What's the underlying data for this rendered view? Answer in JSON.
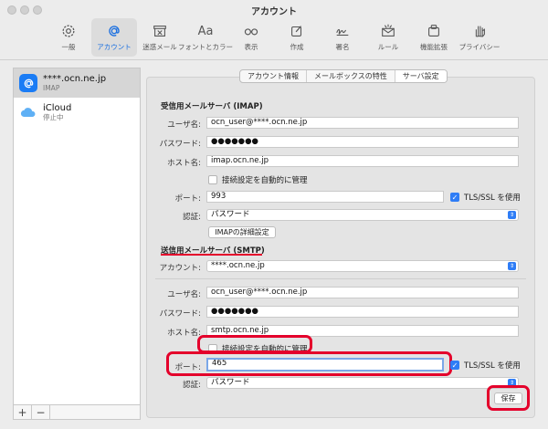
{
  "window": {
    "title": "アカウント"
  },
  "toolbar": {
    "items": [
      {
        "label": "一般",
        "icon": "gear-icon"
      },
      {
        "label": "アカウント",
        "icon": "at-sign-icon",
        "active": true
      },
      {
        "label": "迷惑メール",
        "icon": "junk-mail-icon"
      },
      {
        "label": "フォントとカラー",
        "icon": "font-icon",
        "glyph": "Aa"
      },
      {
        "label": "表示",
        "icon": "glasses-icon"
      },
      {
        "label": "作成",
        "icon": "compose-icon"
      },
      {
        "label": "署名",
        "icon": "signature-icon"
      },
      {
        "label": "ルール",
        "icon": "rules-icon"
      },
      {
        "label": "機能拡張",
        "icon": "extensions-icon"
      },
      {
        "label": "プライバシー",
        "icon": "privacy-hand-icon"
      }
    ]
  },
  "accounts": [
    {
      "name": "****.ocn.ne.jp",
      "sub": "IMAP",
      "selected": true,
      "icon": "at-sign-icon",
      "color": "#1a7cf5"
    },
    {
      "name": "iCloud",
      "sub": "停止中",
      "selected": false,
      "icon": "cloud-icon",
      "color": "#5fb0f5"
    }
  ],
  "list_buttons": {
    "add": "+",
    "remove": "−"
  },
  "tabs": [
    {
      "label": "アカウント情報",
      "active": false
    },
    {
      "label": "メールボックスの特性",
      "active": false
    },
    {
      "label": "サーバ設定",
      "active": true
    }
  ],
  "incoming": {
    "section_title": "受信用メールサーバ (IMAP)",
    "username_label": "ユーザ名:",
    "username": "ocn_user@****.ocn.ne.jp",
    "password_label": "パスワード:",
    "password": "●●●●●●●",
    "host_label": "ホスト名:",
    "host": "imap.ocn.ne.jp",
    "auto_manage_label": "接続設定を自動的に管理",
    "port_label": "ポート:",
    "port": "993",
    "tls_label": "TLS/SSL を使用",
    "auth_label": "認証:",
    "auth": "パスワード",
    "advanced_button": "IMAPの詳細設定"
  },
  "outgoing": {
    "section_title": "送信用メールサーバ (SMTP)",
    "account_label": "アカウント:",
    "account": "****.ocn.ne.jp",
    "username_label": "ユーザ名:",
    "username": "ocn_user@****.ocn.ne.jp",
    "password_label": "パスワード:",
    "password": "●●●●●●●",
    "host_label": "ホスト名:",
    "host": "smtp.ocn.ne.jp",
    "auto_manage_label": "接続設定を自動的に管理",
    "port_label": "ポート:",
    "port": "465",
    "tls_label": "TLS/SSL を使用",
    "auth_label": "認証:",
    "auth": "パスワード"
  },
  "save_button": "保存",
  "colors": {
    "accent": "#2f7df6",
    "highlight": "#e4002b"
  }
}
